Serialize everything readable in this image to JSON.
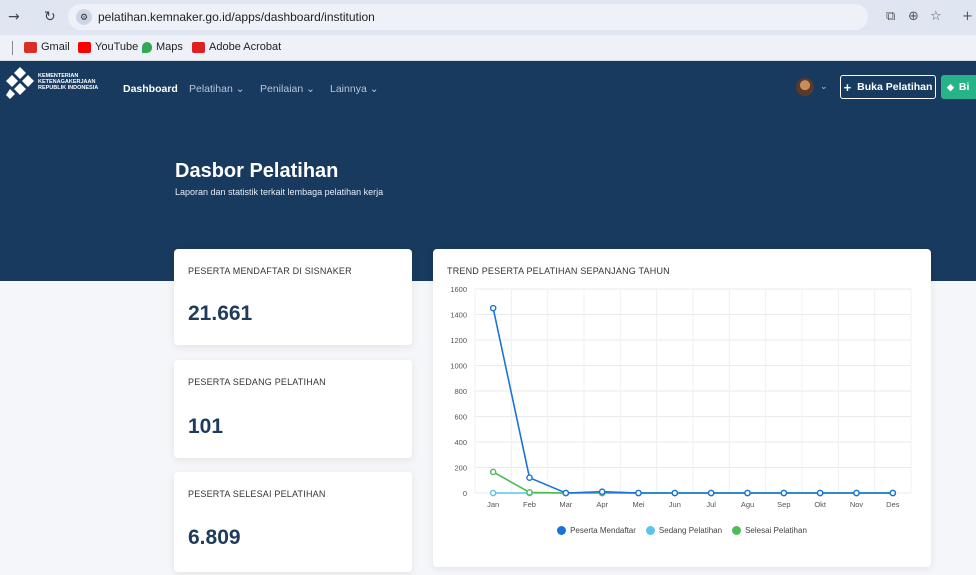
{
  "browser": {
    "url": "pelatihan.kemnaker.go.id/apps/dashboard/institution",
    "bookmarks": [
      {
        "label": "Gmail",
        "icon": "gmail-icon",
        "color": "#d93025"
      },
      {
        "label": "YouTube",
        "icon": "youtube-icon",
        "color": "#ff0000"
      },
      {
        "label": "Maps",
        "icon": "maps-icon",
        "color": "#34a853"
      },
      {
        "label": "Adobe Acrobat",
        "icon": "acrobat-icon",
        "color": "#e02020"
      }
    ]
  },
  "header": {
    "logo_lines": [
      "KEMENTERIAN",
      "KETENAGAKERJAAN",
      "REPUBLIK INDONESIA"
    ],
    "nav": [
      {
        "label": "Dashboard",
        "active": true
      },
      {
        "label": "Pelatihan",
        "has_menu": true
      },
      {
        "label": "Penilaian",
        "has_menu": true
      },
      {
        "label": "Lainnya",
        "has_menu": true
      }
    ],
    "open_training_label": "Buka Pelatihan",
    "green_button_label": "Bi"
  },
  "page": {
    "title": "Dasbor Pelatihan",
    "subtitle": "Laporan dan statistik terkait lembaga pelatihan kerja"
  },
  "stats": [
    {
      "label": "PESERTA MENDAFTAR DI SISNAKER",
      "value": "21.661"
    },
    {
      "label": "PESERTA SEDANG PELATIHAN",
      "value": "101"
    },
    {
      "label": "PESERTA SELESAI PELATIHAN",
      "value": "6.809"
    }
  ],
  "colors": {
    "header_bg": "#173a5e",
    "accent_green": "#26b38a",
    "series_daftar": "#1a73d9",
    "series_sedang": "#5bc4e8",
    "series_selesai": "#4cbb5a"
  },
  "chart_data": {
    "type": "line",
    "title": "TREND PESERTA PELATIHAN SEPANJANG TAHUN",
    "categories": [
      "Jan",
      "Feb",
      "Mar",
      "Apr",
      "Mei",
      "Jun",
      "Jul",
      "Agu",
      "Sep",
      "Okt",
      "Nov",
      "Des"
    ],
    "yticks": [
      0,
      200,
      400,
      600,
      800,
      1000,
      1200,
      1400,
      1600
    ],
    "ylim": [
      0,
      1600
    ],
    "grid": true,
    "legend_position": "bottom",
    "series": [
      {
        "name": "Peserta Mendaftar",
        "color": "#1a73d9",
        "values": [
          1450,
          120,
          0,
          10,
          0,
          0,
          0,
          0,
          0,
          0,
          0,
          0
        ]
      },
      {
        "name": "Sedang Pelatihan",
        "color": "#5bc4e8",
        "values": [
          0,
          0,
          0,
          0,
          0,
          0,
          0,
          0,
          0,
          0,
          0,
          0
        ]
      },
      {
        "name": "Selesai Pelatihan",
        "color": "#4cbb5a",
        "values": [
          165,
          5,
          0,
          0,
          0,
          0,
          0,
          0,
          0,
          0,
          0,
          0
        ]
      }
    ]
  }
}
